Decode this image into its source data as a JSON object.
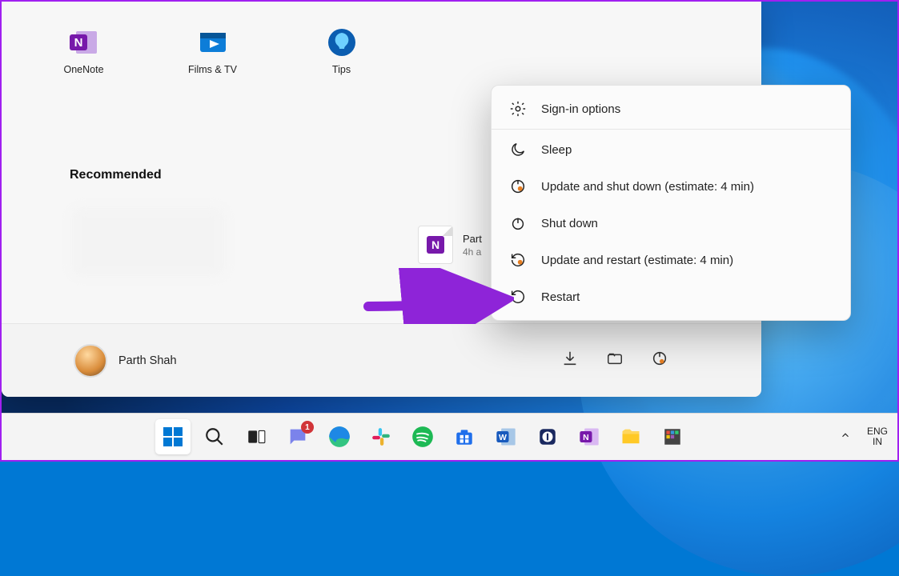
{
  "pinned_apps": [
    {
      "name": "onenote",
      "label": "OneNote"
    },
    {
      "name": "films-tv",
      "label": "Films & TV"
    },
    {
      "name": "tips",
      "label": "Tips"
    }
  ],
  "recommended": {
    "header": "Recommended",
    "items": [
      {
        "title": "Part",
        "subtitle": "4h a"
      }
    ]
  },
  "user": {
    "name": "Parth Shah"
  },
  "power_menu": {
    "sign_in_options": "Sign-in options",
    "sleep": "Sleep",
    "update_shutdown": "Update and shut down (estimate: 4 min)",
    "shutdown": "Shut down",
    "update_restart": "Update and restart (estimate: 4 min)",
    "restart": "Restart"
  },
  "taskbar": {
    "chat_badge": "1",
    "language": {
      "top": "ENG",
      "bottom": "IN"
    }
  }
}
